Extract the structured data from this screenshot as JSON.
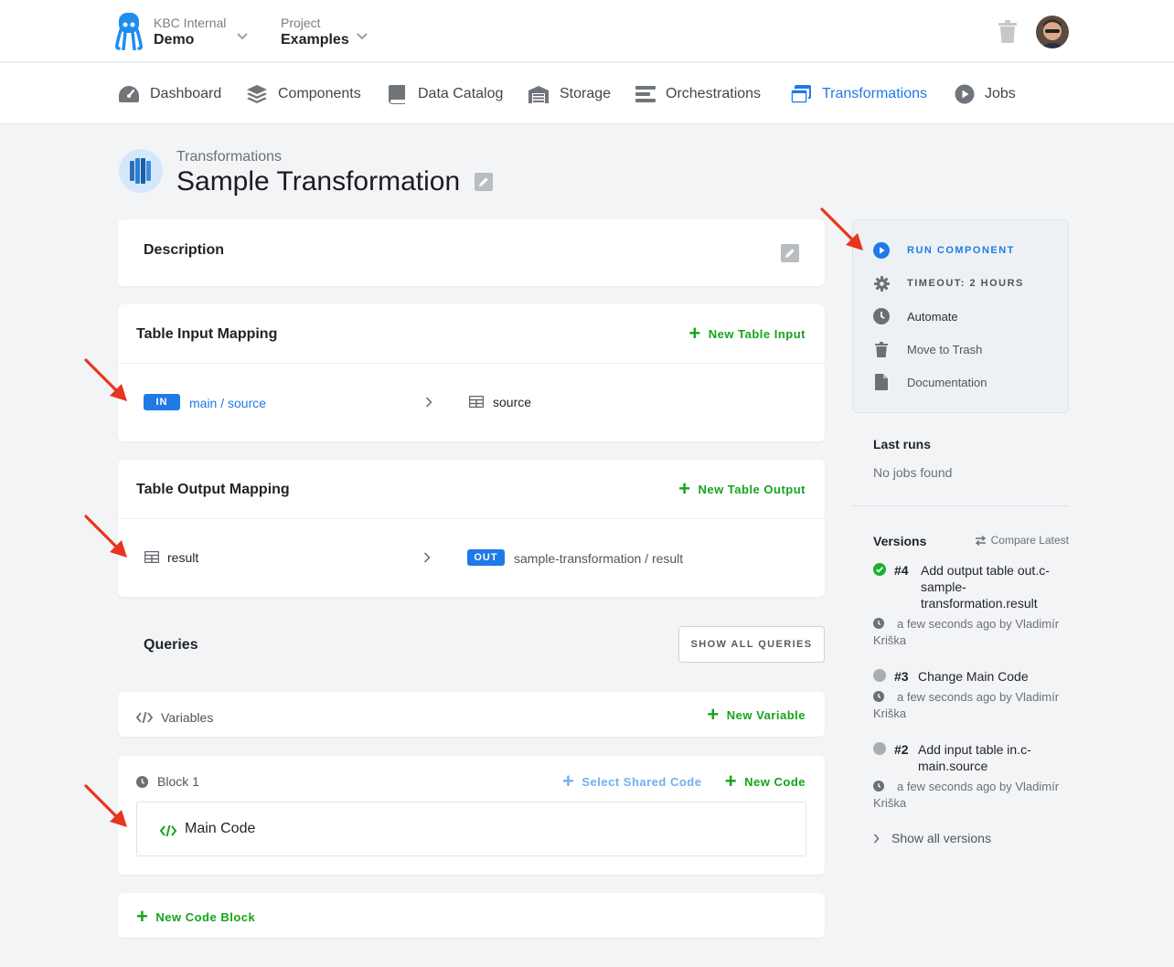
{
  "topbar": {
    "org_label": "KBC Internal",
    "org_name": "Demo",
    "project_label": "Project",
    "project_name": "Examples"
  },
  "nav": [
    {
      "label": "Dashboard",
      "icon": "dashboard-icon"
    },
    {
      "label": "Components",
      "icon": "layers-icon"
    },
    {
      "label": "Data Catalog",
      "icon": "book-icon"
    },
    {
      "label": "Storage",
      "icon": "warehouse-icon"
    },
    {
      "label": "Orchestrations",
      "icon": "bars-icon"
    },
    {
      "label": "Transformations",
      "icon": "window-stack-icon",
      "active": true
    },
    {
      "label": "Jobs",
      "icon": "play-circle-icon"
    }
  ],
  "header": {
    "breadcrumb": "Transformations",
    "title": "Sample Transformation"
  },
  "description": {
    "title": "Description"
  },
  "input_mapping": {
    "title": "Table Input Mapping",
    "add_label": "New Table Input",
    "badge": "IN",
    "source": "main / source",
    "destination": "source"
  },
  "output_mapping": {
    "title": "Table Output Mapping",
    "add_label": "New Table Output",
    "source": "result",
    "badge": "OUT",
    "destination": "sample-transformation / result"
  },
  "queries": {
    "title": "Queries",
    "show_all_label": "SHOW ALL QUERIES",
    "variables_label": "Variables",
    "new_variable_label": "New Variable",
    "block_label": "Block 1",
    "select_shared_label": "Select Shared Code",
    "new_code_label": "New Code",
    "code_label": "Main Code",
    "new_block_label": "New Code Block"
  },
  "sidebar": {
    "run": "RUN COMPONENT",
    "timeout": "TIMEOUT: 2 HOURS",
    "automate": "Automate",
    "trash": "Move to Trash",
    "docs": "Documentation",
    "last_runs_title": "Last runs",
    "last_runs_empty": "No jobs found",
    "versions_title": "Versions",
    "compare_label": "Compare Latest",
    "versions": [
      {
        "num": "#4",
        "line1": "Add output table out.c-",
        "line2": "sample-",
        "line3": "transformation.result",
        "meta1": "a few seconds ago by Vladimír",
        "meta2": "Kriška",
        "status_color": "#19b32b"
      },
      {
        "num": "#3",
        "line1": "Change Main Code",
        "meta1": "a few seconds ago by Vladimír",
        "meta2": "Kriška",
        "status_color": "#a9acb0"
      },
      {
        "num": "#2",
        "line1": "Add input table in.c-",
        "line2": "main.source",
        "meta1": "a few seconds ago by Vladimír",
        "meta2": "Kriška",
        "status_color": "#a9acb0"
      }
    ],
    "show_all_versions": "Show all versions"
  },
  "colors": {
    "accent_blue": "#1f7ae8",
    "action_green": "#15a41b",
    "annotation_red": "#e8351f"
  }
}
